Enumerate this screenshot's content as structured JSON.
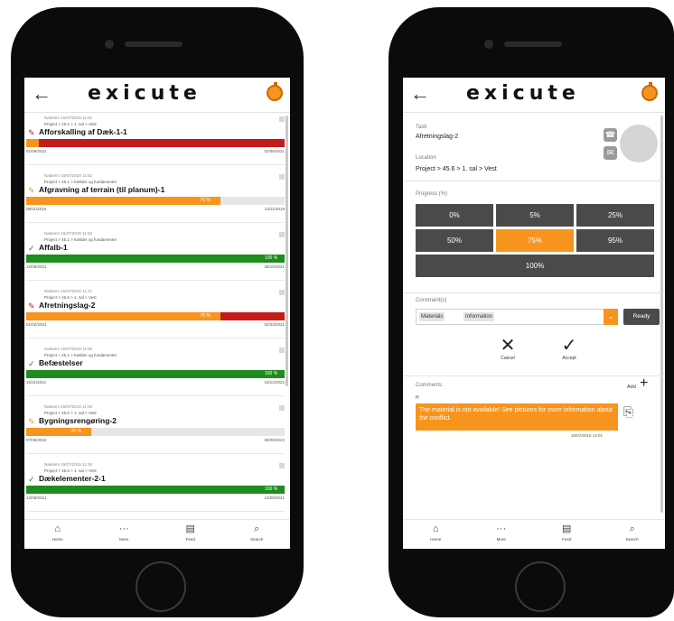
{
  "colors": {
    "accent": "#f7941d",
    "red": "#c41a1a",
    "green": "#1e8c1e",
    "dark": "#4a4a4a"
  },
  "app": {
    "logo": "exicute"
  },
  "left": {
    "tasks": [
      {
        "meta1": "Nadeem 15/07/2019 11:52",
        "meta2": "Project > 15.1 > 1. sal > Vest",
        "icon": "pencil-icon",
        "name": "Afforskalling af Dæk-1-1",
        "progress": 0.05,
        "status": "red",
        "pct": "",
        "d1": "01/06/2021",
        "d2": "02/06/2021"
      },
      {
        "meta1": "Nadeem 15/07/2019 11:52",
        "meta2": "Project > 45.1 > Kælder og fundamenter",
        "icon": "pencil-icon",
        "name": "Afgravning af terrain (til planum)-1",
        "progress": 0.75,
        "status": "orange",
        "pct": "75 %",
        "d1": "08/11/2019",
        "d2": "13/11/2019"
      },
      {
        "meta1": "Nadeem 15/07/2019 11:52",
        "meta2": "Project > 45.1 > Kælder og fundamenter",
        "icon": "check-icon",
        "name": "Affalb-1",
        "progress": 1.0,
        "status": "green",
        "pct": "100 %",
        "d1": "12/09/2021",
        "d2": "28/10/2021"
      },
      {
        "meta1": "Nadeem 15/07/2019 11:17",
        "meta2": "Project > 45.6 > 1. sal > Vest",
        "icon": "pencil-icon",
        "name": "Afretningslag-2",
        "progress": 0.75,
        "status": "red",
        "pct": "75 %",
        "d1": "01/02/2021",
        "d2": "02/03/2021"
      },
      {
        "meta1": "Nadeem 15/07/2019 11:08",
        "meta2": "Project > 45.1 > Kælder og fundamenter",
        "icon": "check-icon",
        "name": "Befæstelser",
        "progress": 1.0,
        "status": "green",
        "pct": "100 %",
        "d1": "15/11/2021",
        "d2": "15/12/2022"
      },
      {
        "meta1": "Nadeem 15/07/2019 11:08",
        "meta2": "Project > 45.6 > 1. sal > Vest",
        "icon": "pencil-icon",
        "name": "Bygningsrengøring-2",
        "progress": 0.25,
        "status": "orange",
        "pct": "25 %",
        "d1": "07/06/2022",
        "d2": "08/06/2022"
      },
      {
        "meta1": "Nadeem 15/07/2019 11:18",
        "meta2": "Project > 45.6 > 1. sal > Vest",
        "icon": "check-icon",
        "name": "Dækelementer-2-1",
        "progress": 1.0,
        "status": "green",
        "pct": "100 %",
        "d1": "12/09/2021",
        "d2": "13/09/2021"
      }
    ]
  },
  "nav": [
    {
      "icon": "home-icon",
      "glyph": "⌂",
      "label": "Home"
    },
    {
      "icon": "more-icon",
      "glyph": "···",
      "label": "More"
    },
    {
      "icon": "feed-icon",
      "glyph": "▤",
      "label": "Feed"
    },
    {
      "icon": "search-icon",
      "glyph": "⌕",
      "label": "Search"
    }
  ],
  "right": {
    "task_label": "Task",
    "task_value": "Afretningslag-2",
    "location_label": "Location",
    "location_value": "Project > 45.6 > 1. sal > Vest",
    "progress_label": "Progress (%)",
    "progress_options": [
      "0%",
      "5%",
      "25%",
      "50%",
      "75%",
      "95%",
      "100%"
    ],
    "progress_selected": "75%",
    "constraint_label": "Constraint(s)",
    "constraint_chips": [
      "Materials",
      "Information"
    ],
    "ready_label": "Ready",
    "cancel_label": "Cancel",
    "accept_label": "Accept",
    "comments_label": "Comments",
    "add_label": "Add",
    "comment_author": "H",
    "comment_text": "The material is not available! See pictures for more information about the conflict.",
    "comment_time": "10/07/2019 14:01"
  }
}
